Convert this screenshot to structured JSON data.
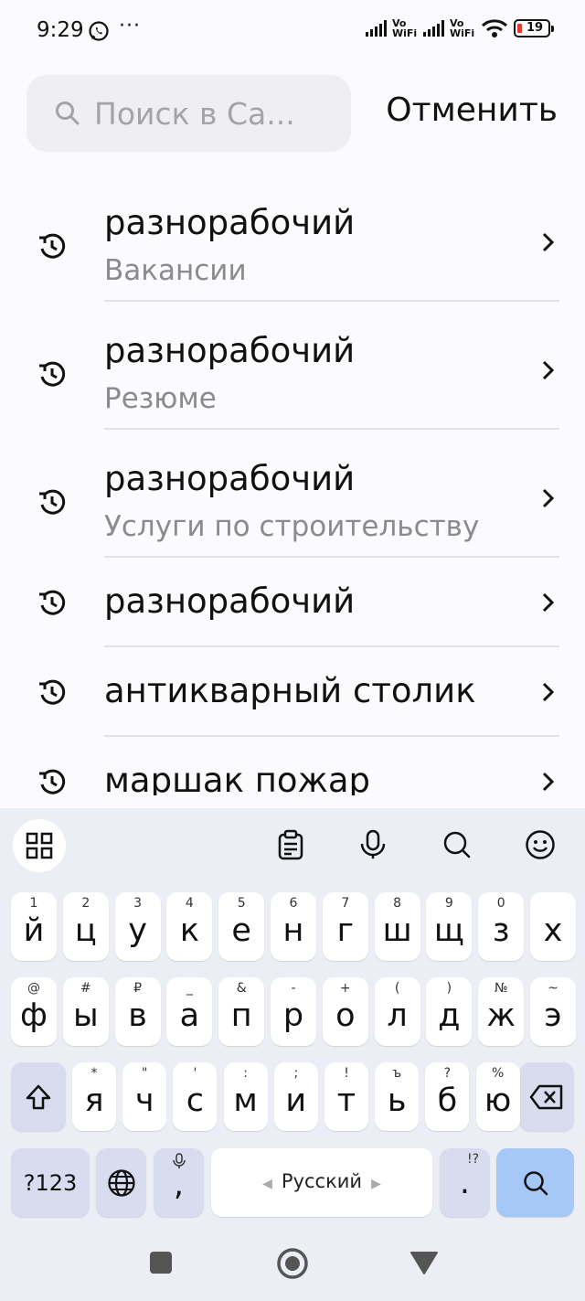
{
  "status_bar": {
    "time": "9:29",
    "vo_wifi_1": "Vo WiFi",
    "vo_wifi_2": "Vo WiFi",
    "battery": "19",
    "battery_color": "#e53935"
  },
  "search": {
    "placeholder": "Поиск в Са...",
    "value": "",
    "cancel_label": "Отменить"
  },
  "history": [
    {
      "title": "разнорабочий",
      "category": "Вакансии"
    },
    {
      "title": "разнорабочий",
      "category": "Резюме"
    },
    {
      "title": "разнорабочий",
      "category": "Услуги по строительству"
    },
    {
      "title": "разнорабочий",
      "category": ""
    },
    {
      "title": "антикварный столик",
      "category": ""
    },
    {
      "title": "маршак пожар",
      "category": ""
    }
  ],
  "keyboard": {
    "row1": [
      {
        "char": "й",
        "hint": "1"
      },
      {
        "char": "ц",
        "hint": "2"
      },
      {
        "char": "у",
        "hint": "3"
      },
      {
        "char": "к",
        "hint": "4"
      },
      {
        "char": "е",
        "hint": "5"
      },
      {
        "char": "н",
        "hint": "6"
      },
      {
        "char": "г",
        "hint": "7"
      },
      {
        "char": "ш",
        "hint": "8"
      },
      {
        "char": "щ",
        "hint": "9"
      },
      {
        "char": "з",
        "hint": "0"
      },
      {
        "char": "х",
        "hint": ""
      }
    ],
    "row2": [
      {
        "char": "ф",
        "hint": "@"
      },
      {
        "char": "ы",
        "hint": "#"
      },
      {
        "char": "в",
        "hint": "₽"
      },
      {
        "char": "а",
        "hint": "_"
      },
      {
        "char": "п",
        "hint": "&"
      },
      {
        "char": "р",
        "hint": "-"
      },
      {
        "char": "о",
        "hint": "+"
      },
      {
        "char": "л",
        "hint": "("
      },
      {
        "char": "д",
        "hint": ")"
      },
      {
        "char": "ж",
        "hint": "№"
      },
      {
        "char": "э",
        "hint": "~"
      }
    ],
    "row3": [
      {
        "char": "я",
        "hint": "*"
      },
      {
        "char": "ч",
        "hint": "\""
      },
      {
        "char": "с",
        "hint": "'"
      },
      {
        "char": "м",
        "hint": ":"
      },
      {
        "char": "и",
        "hint": ";"
      },
      {
        "char": "т",
        "hint": "!"
      },
      {
        "char": "ь",
        "hint": "ъ"
      },
      {
        "char": "б",
        "hint": "?"
      },
      {
        "char": "ю",
        "hint": "%"
      }
    ],
    "symbols_label": "?123",
    "comma": ",",
    "space_label": "Русский",
    "period": ".",
    "period_hint": "!?",
    "accent_color": "#a6c8f7"
  }
}
